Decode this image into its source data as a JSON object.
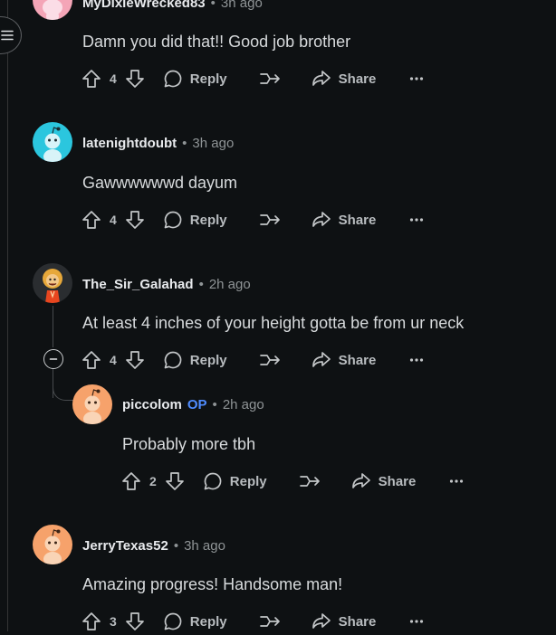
{
  "comments": [
    {
      "username": "MyDixieWrecked83",
      "time": "3h ago",
      "text": "Damn you did that!! Good job brother",
      "votes": "4"
    },
    {
      "username": "latenightdoubt",
      "time": "3h ago",
      "text": "Gawwwwwwd dayum",
      "votes": "4"
    },
    {
      "username": "The_Sir_Galahad",
      "time": "2h ago",
      "text": "At least 4 inches of your height gotta be from ur neck",
      "votes": "4"
    },
    {
      "username": "piccolom",
      "op": "OP",
      "time": "2h ago",
      "text": "Probably more tbh",
      "votes": "2"
    },
    {
      "username": "JerryTexas52",
      "time": "3h ago",
      "text": "Amazing progress! Handsome man!",
      "votes": "3"
    }
  ],
  "labels": {
    "reply": "Reply",
    "share": "Share",
    "dot": "•"
  },
  "colors": {
    "background": "#0e1113",
    "op_badge": "#4f8cff",
    "avatar_cyan": "#2bc6de",
    "avatar_orange": "#f6a26b"
  }
}
